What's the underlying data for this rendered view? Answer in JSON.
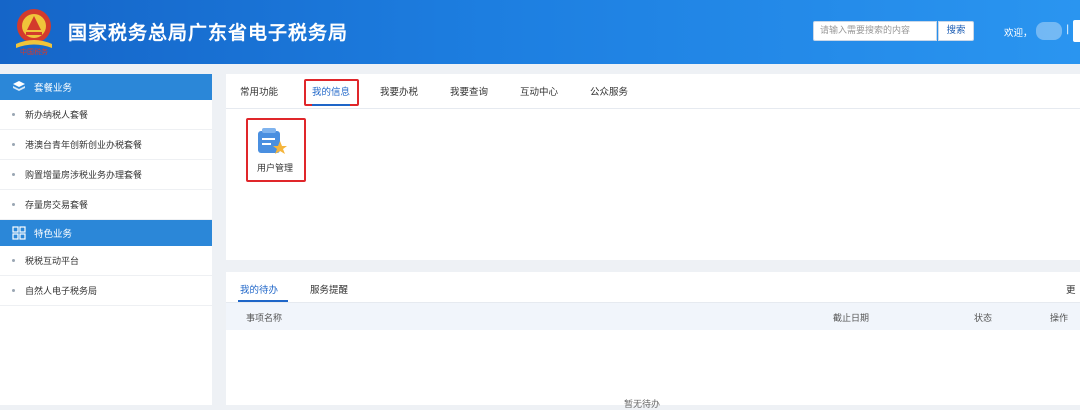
{
  "header": {
    "title": "国家税务总局广东省电子税务局",
    "search_placeholder": "请输入需要搜索的内容",
    "search_button": "搜索",
    "welcome": "欢迎，",
    "separator": "|"
  },
  "sidebar": {
    "section1": {
      "title": "套餐业务",
      "icon": "package-icon"
    },
    "items1": [
      {
        "label": "新办纳税人套餐"
      },
      {
        "label": "港澳台青年创新创业办税套餐"
      },
      {
        "label": "购置增量房涉税业务办理套餐"
      },
      {
        "label": "存量房交易套餐"
      }
    ],
    "section2": {
      "title": "特色业务",
      "icon": "grid-icon"
    },
    "items2": [
      {
        "label": "税税互动平台"
      },
      {
        "label": "自然人电子税务局"
      }
    ]
  },
  "main": {
    "tabs": [
      {
        "label": "常用功能"
      },
      {
        "label": "我的信息"
      },
      {
        "label": "我要办税"
      },
      {
        "label": "我要查询"
      },
      {
        "label": "互动中心"
      },
      {
        "label": "公众服务"
      }
    ],
    "active_tab": "我的信息",
    "function": {
      "label": "用户管理",
      "icon": "user-management-icon"
    }
  },
  "todo": {
    "tabs": [
      {
        "label": "我的待办"
      },
      {
        "label": "服务提醒"
      }
    ],
    "more_label": "更",
    "columns": [
      {
        "label": "事项名称"
      },
      {
        "label": "截止日期"
      },
      {
        "label": "状态"
      },
      {
        "label": "操作"
      }
    ],
    "empty_text": "暂无待办"
  },
  "colors": {
    "header_blue": "#1d7ee0",
    "accent_blue": "#1f66c8",
    "highlight_red": "#e0262a"
  }
}
